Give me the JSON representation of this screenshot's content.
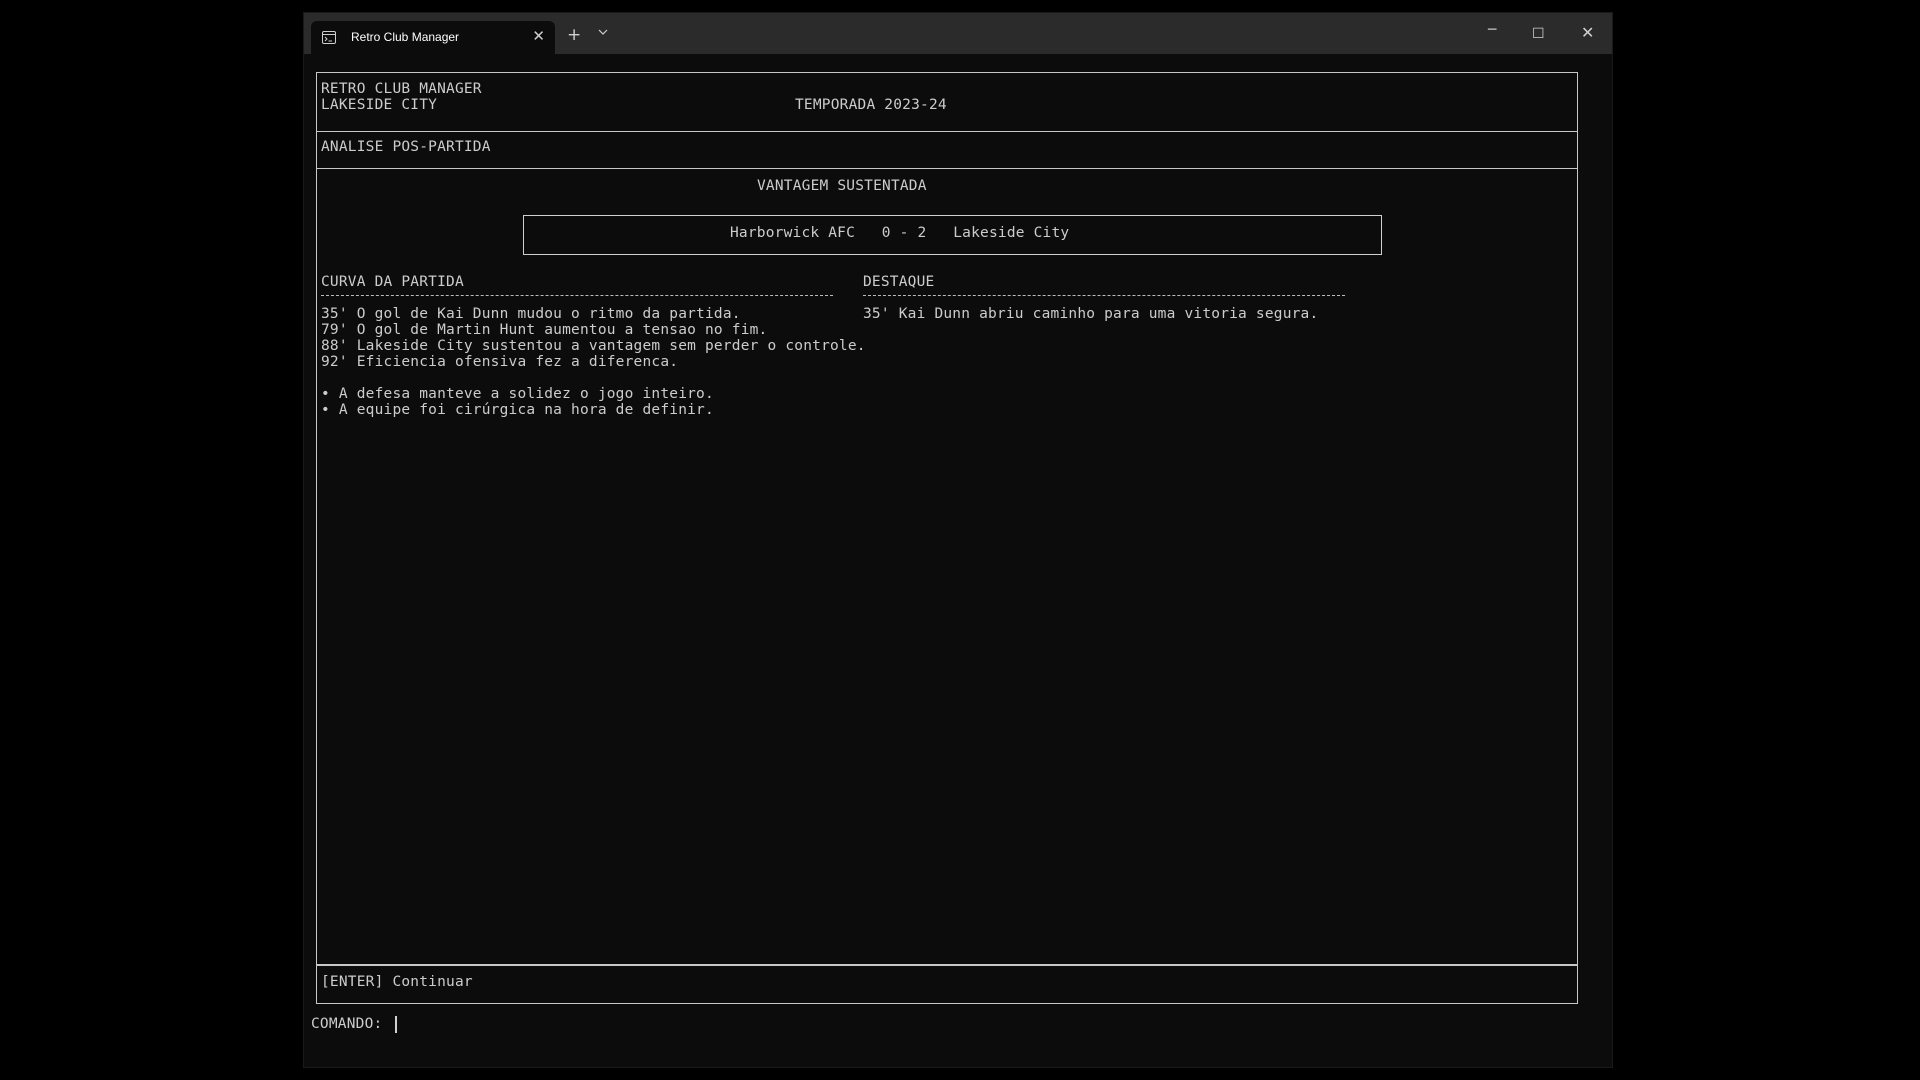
{
  "window": {
    "tab_title": "Retro Club Manager",
    "icons": {
      "tab_icon": "terminal-icon",
      "close_tab": "close-icon",
      "new_tab": "plus-icon",
      "tab_dropdown": "chevron-down-icon",
      "minimize": "minimize-icon",
      "maximize": "maximize-icon",
      "close_window": "close-icon"
    },
    "labels": {
      "close_tab": "✕",
      "new_tab": "+",
      "minimize": "─",
      "maximize": "☐",
      "close_window": "✕"
    }
  },
  "header": {
    "app_name": "RETRO CLUB MANAGER",
    "club": "LAKESIDE CITY",
    "season": "TEMPORADA 2023-24"
  },
  "section_title": "ANALISE POS-PARTIDA",
  "main": {
    "headline": "VANTAGEM SUSTENTADA",
    "scoreline": "Harborwick AFC   0 - 2   Lakeside City",
    "curve": {
      "title": "CURVA DA PARTIDA",
      "events": [
        "35' O gol de Kai Dunn mudou o ritmo da partida.",
        "79' O gol de Martin Hunt aumentou a tensao no fim.",
        "88' Lakeside City sustentou a vantagem sem perder o controle.",
        "92' Eficiencia ofensiva fez a diferenca."
      ],
      "bullets": [
        "• A defesa manteve a solidez o jogo inteiro.",
        "• A equipe foi cirúrgica na hora de definir."
      ]
    },
    "highlight": {
      "title": "DESTAQUE",
      "text": "35' Kai Dunn abriu caminho para uma vitoria segura."
    }
  },
  "footer": {
    "hint": "[ENTER] Continuar"
  },
  "command": {
    "prompt": "COMANDO:",
    "value": ""
  },
  "colors": {
    "background": "#0c0c0c",
    "titlebar": "#2b2b2b",
    "text": "#cccccc",
    "border": "#c8c8c8"
  }
}
